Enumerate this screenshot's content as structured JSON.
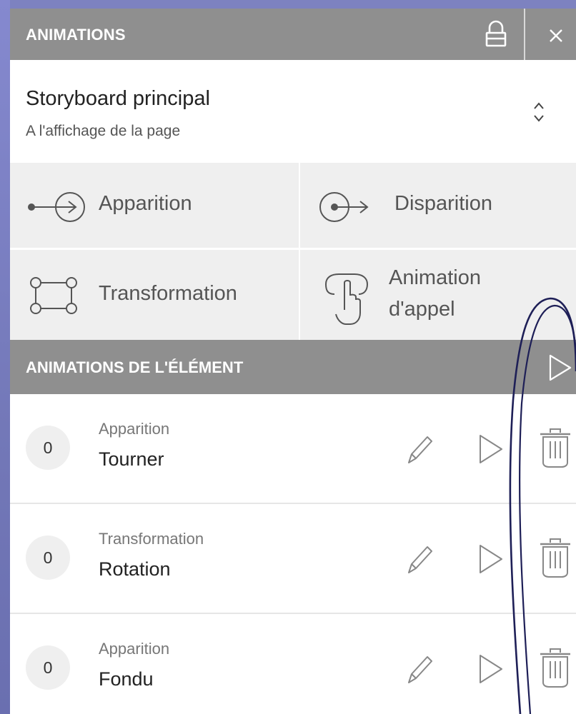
{
  "panel": {
    "title": "ANIMATIONS"
  },
  "storyboard": {
    "name": "Storyboard principal",
    "trigger": "A l'affichage de la page"
  },
  "animation_types": [
    {
      "label": "Apparition",
      "icon": "entrance-arrow-icon"
    },
    {
      "label": "Disparition",
      "icon": "exit-arrow-icon"
    },
    {
      "label": "Transformation",
      "icon": "transform-nodes-icon"
    },
    {
      "label_line1": "Animation",
      "label_line2": "d'appel",
      "icon": "tap-hand-icon"
    }
  ],
  "element_animations": {
    "title": "ANIMATIONS DE L'ÉLÉMENT",
    "items": [
      {
        "order": "0",
        "kind": "Apparition",
        "effect": "Tourner"
      },
      {
        "order": "0",
        "kind": "Transformation",
        "effect": "Rotation"
      },
      {
        "order": "0",
        "kind": "Apparition",
        "effect": "Fondu"
      }
    ]
  },
  "colors": {
    "header_bg": "#8f8f8f",
    "grid_bg": "#efefef",
    "annotation_stroke": "#1e1f57"
  }
}
